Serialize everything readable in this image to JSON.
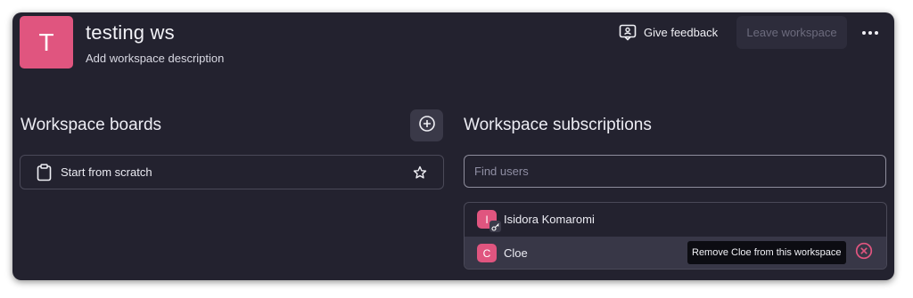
{
  "workspace": {
    "avatar_letter": "T",
    "avatar_color": "#e0557f",
    "title": "testing ws",
    "description": "Add workspace description"
  },
  "header": {
    "feedback_label": "Give feedback",
    "feedback_icon": "feedback-icon",
    "leave_label": "Leave workspace",
    "more_icon": "more-horizontal-icon"
  },
  "boards": {
    "title": "Workspace boards",
    "add_icon": "plus-circle-icon",
    "items": [
      {
        "label": "Start from scratch",
        "icon": "clipboard-icon",
        "action_icon": "star-icon"
      }
    ]
  },
  "subscriptions": {
    "title": "Workspace subscriptions",
    "search_placeholder": "Find users",
    "search_value": "",
    "members": [
      {
        "initial": "I",
        "name": "Isidora Komaromi",
        "badge_icon": "key-icon"
      },
      {
        "initial": "C",
        "name": "Cloe"
      }
    ],
    "tooltip": "Remove Cloe from this workspace",
    "remove_icon": "remove-circle-icon"
  },
  "colors": {
    "background": "#23222f",
    "accent": "#e0557f",
    "remove": "#e0557f"
  }
}
